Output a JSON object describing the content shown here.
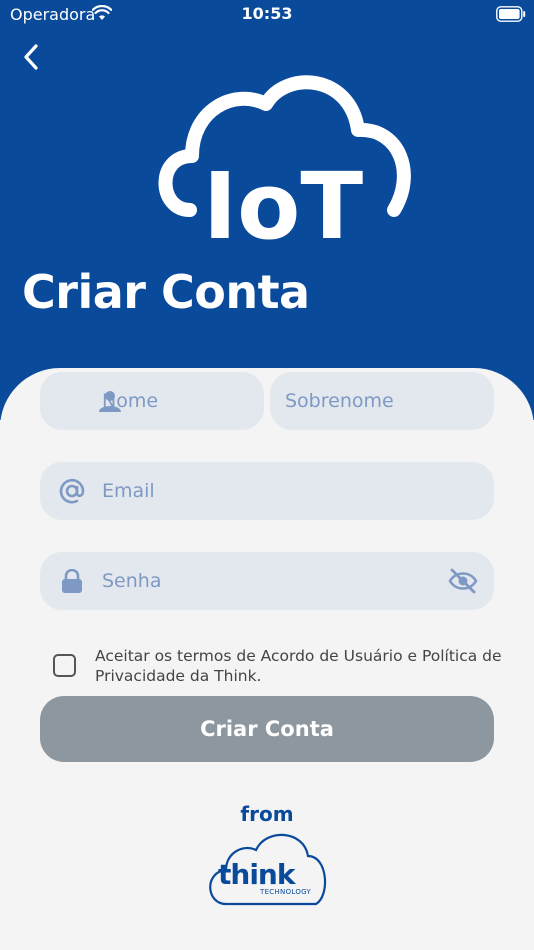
{
  "status_bar": {
    "carrier": "Operadora",
    "time": "10:53"
  },
  "header": {
    "title": "Criar Conta",
    "back_icon": "chevron-left-icon",
    "logo_text": "IoT"
  },
  "form": {
    "first_name": {
      "placeholder": "Nome",
      "icon": "person-icon",
      "value": ""
    },
    "last_name": {
      "placeholder": "Sobrenome",
      "value": ""
    },
    "email": {
      "placeholder": "Email",
      "icon": "at-icon",
      "value": ""
    },
    "password": {
      "placeholder": "Senha",
      "icon": "lock-icon",
      "toggle_icon": "eye-slash-icon",
      "value": ""
    },
    "terms": {
      "text": "Aceitar os termos de Acordo de Usuário e Política de Privacidade da Think.",
      "checked": false
    },
    "submit_label": "Criar Conta"
  },
  "footer": {
    "from_label": "from",
    "brand": "think",
    "brand_sub": "TECHNOLOGY"
  },
  "colors": {
    "primary": "#0a4a9b",
    "field_bg": "#e3e7ee",
    "placeholder": "#7e9ac4",
    "button_disabled": "#8d979f",
    "background": "#f4f4f4"
  }
}
